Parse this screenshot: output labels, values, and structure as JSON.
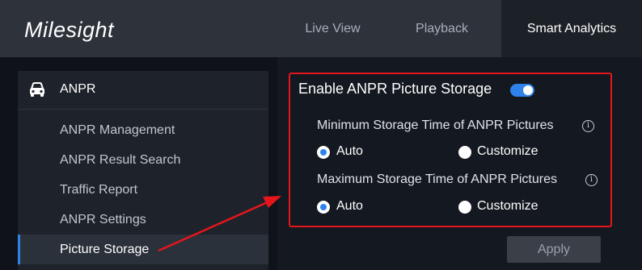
{
  "header": {
    "logo_text": "Milesight",
    "tabs": [
      {
        "label": "Live View",
        "active": false
      },
      {
        "label": "Playback",
        "active": false
      },
      {
        "label": "Smart Analytics",
        "active": true
      }
    ]
  },
  "sidebar": {
    "section_title": "ANPR",
    "section_icon": "car-icon",
    "items": [
      {
        "label": "ANPR Management",
        "active": false
      },
      {
        "label": "ANPR Result Search",
        "active": false
      },
      {
        "label": "Traffic Report",
        "active": false
      },
      {
        "label": "ANPR Settings",
        "active": false
      },
      {
        "label": "Picture Storage",
        "active": true
      }
    ]
  },
  "main": {
    "enable_label": "Enable ANPR Picture Storage",
    "enable_on": true,
    "min_storage": {
      "label": "Minimum Storage Time of ANPR Pictures",
      "options": [
        "Auto",
        "Customize"
      ],
      "selected": "Auto"
    },
    "max_storage": {
      "label": "Maximum Storage Time of ANPR Pictures",
      "options": [
        "Auto",
        "Customize"
      ],
      "selected": "Auto"
    },
    "apply_label": "Apply"
  },
  "colors": {
    "accent": "#2f82e9",
    "highlight": "#e4161c",
    "header_bg": "#2d323b"
  }
}
